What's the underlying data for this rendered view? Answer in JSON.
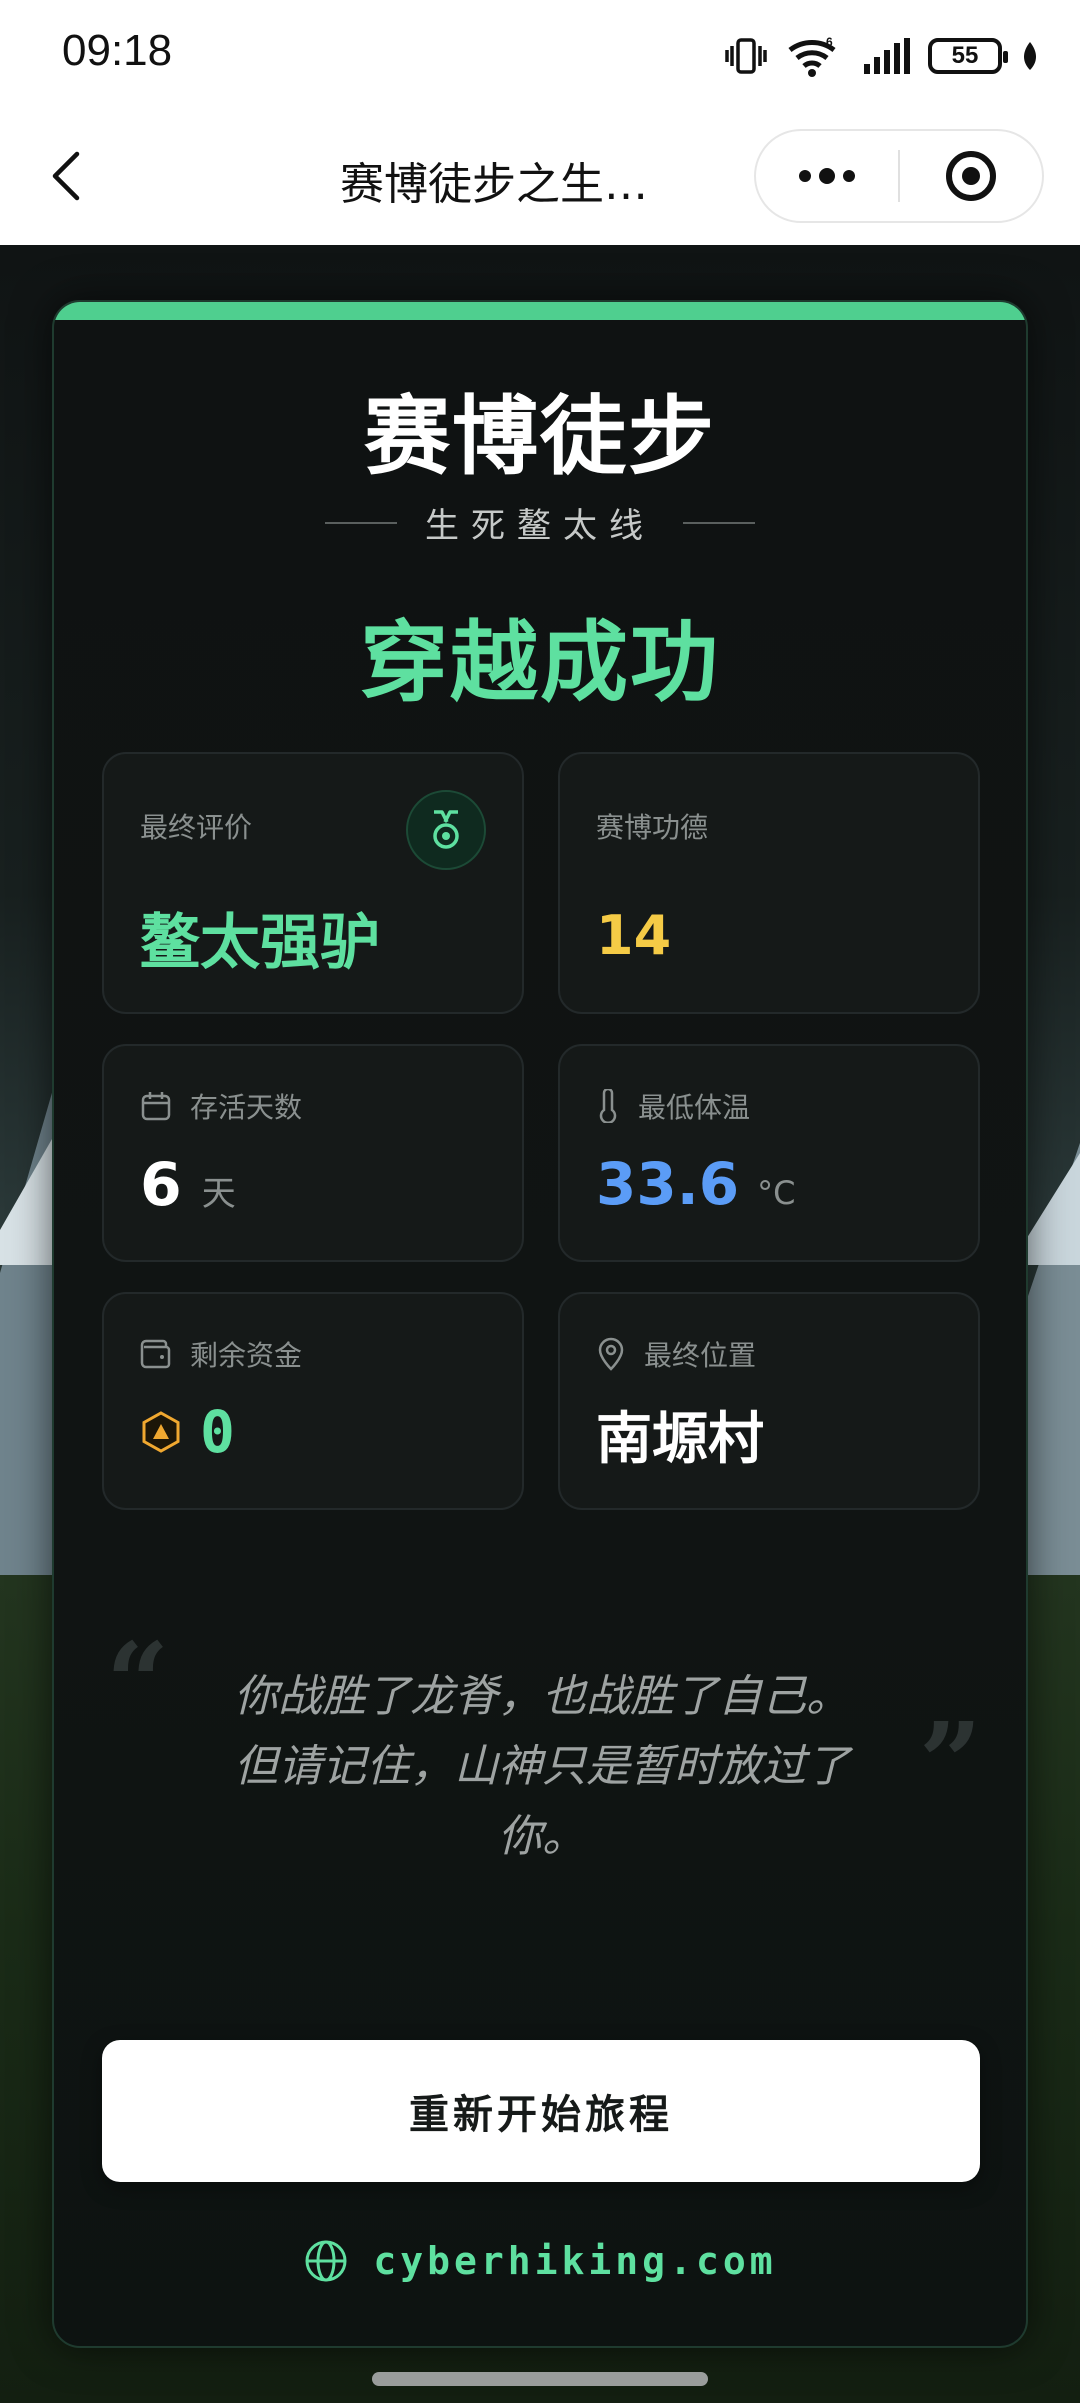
{
  "status_bar": {
    "time": "09:18",
    "battery": "55"
  },
  "nav": {
    "title": "赛博徒步之生…"
  },
  "card": {
    "title": "赛博徒步",
    "subtitle": "生死鳌太线",
    "result": "穿越成功",
    "accent_color": "#4fcf8f"
  },
  "stats": {
    "final_rating": {
      "label": "最终评价",
      "value": "鳌太强驴",
      "icon": "medal-icon"
    },
    "cyber_merit": {
      "label": "赛博功德",
      "value": "14"
    },
    "survival_days": {
      "label": "存活天数",
      "value": "6",
      "unit": "天",
      "icon": "calendar-icon"
    },
    "min_temp": {
      "label": "最低体温",
      "value": "33.6",
      "unit": "°C",
      "icon": "thermometer-icon"
    },
    "funds": {
      "label": "剩余资金",
      "value": "0",
      "icon": "wallet-icon"
    },
    "location": {
      "label": "最终位置",
      "value": "南塬村",
      "icon": "location-pin-icon"
    }
  },
  "quote": {
    "line1": "你战胜了龙脊，也战胜了自己。",
    "line2": "但请记住，山神只是暂时放过了",
    "line3": "你。"
  },
  "restart_button": "重新开始旅程",
  "site": "cyberhiking.com"
}
